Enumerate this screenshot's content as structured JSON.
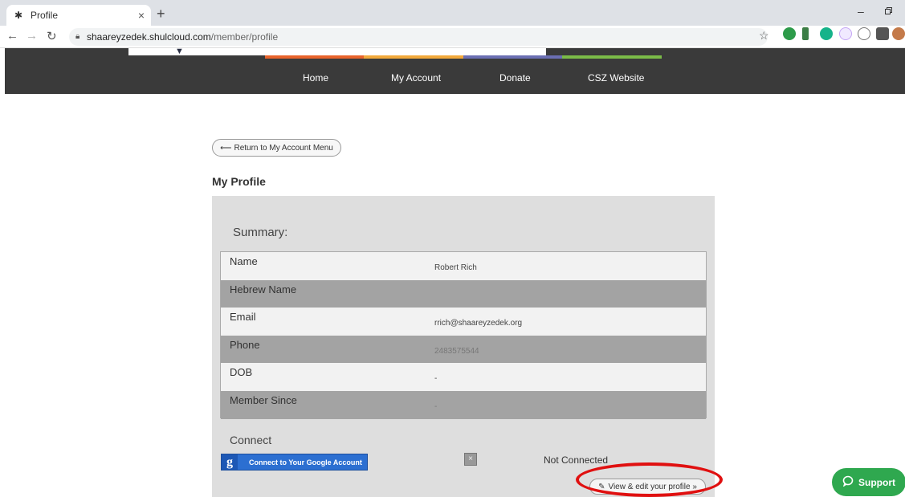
{
  "browser": {
    "tab_title": "Profile",
    "tab_close": "×",
    "new_tab": "+",
    "url_host": "shaareyzedek.shulcloud.com",
    "url_path": "/member/profile",
    "minimize": "–",
    "restore": "▫",
    "icons": [
      "back-arrow-icon",
      "forward-arrow-icon",
      "reload-icon",
      "lock-icon",
      "star-icon",
      "extension-icons"
    ]
  },
  "nav": {
    "items": [
      {
        "label": "Home",
        "accent": "#e8632b"
      },
      {
        "label": "My Account",
        "accent": "#f2a93b"
      },
      {
        "label": "Donate",
        "accent": "#6b6fb3"
      },
      {
        "label": "CSZ Website",
        "accent": "#7bbb48"
      }
    ]
  },
  "page": {
    "back_label": "Return to My Account Menu",
    "title": "My Profile",
    "summary_title": "Summary:",
    "rows": [
      {
        "label": "Name",
        "value": "Robert Rich"
      },
      {
        "label": "Hebrew Name",
        "value": ""
      },
      {
        "label": "Email",
        "value": "rrich@shaareyzedek.org"
      },
      {
        "label": "Phone",
        "value": "2483575544"
      },
      {
        "label": "DOB",
        "value": "-"
      },
      {
        "label": "Member Since",
        "value": "-"
      }
    ],
    "connect_title": "Connect",
    "google_button": "Connect to Your Google Account",
    "google_glyph": "g",
    "remove_glyph": "×",
    "connection_status": "Not Connected",
    "edit_profile": "View & edit your profile »"
  },
  "support": {
    "label": "Support"
  },
  "colors": {
    "header_bg": "#3a3a3a",
    "panel_bg": "#dedede",
    "highlight": "#e01010",
    "support": "#2fa84f"
  }
}
